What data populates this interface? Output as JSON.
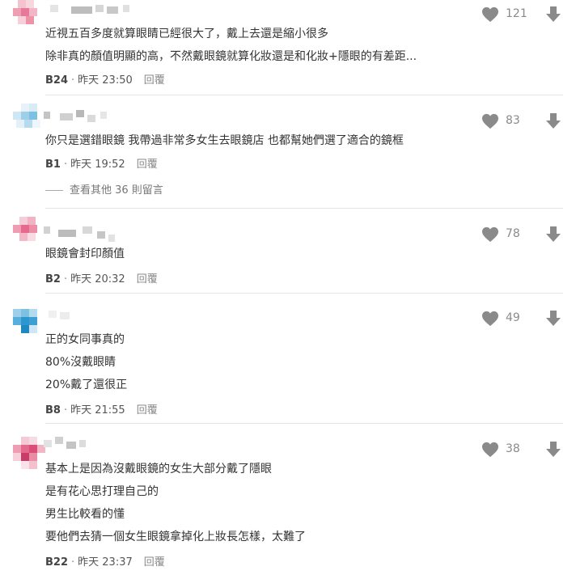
{
  "comments": [
    {
      "floor": "B24",
      "time": "昨天 23:50",
      "reply": "回覆",
      "likes": "121",
      "lines": [
        "近視五百多度就算眼睛已經很大了，戴上去還是縮小很多",
        "除非真的顏值明顯的高，不然戴眼鏡就算化妝還是和化妝+隱眼的有差距..."
      ]
    },
    {
      "floor": "B1",
      "time": "昨天 19:52",
      "reply": "回覆",
      "likes": "83",
      "lines": [
        "你只是選錯眼鏡 我帶過非常多女生去眼鏡店 也都幫她們選了適合的鏡框"
      ],
      "more_replies": "查看其他 36 則留言"
    },
    {
      "floor": "B2",
      "time": "昨天 20:32",
      "reply": "回覆",
      "likes": "78",
      "lines": [
        "眼鏡會封印顏值"
      ]
    },
    {
      "floor": "B8",
      "time": "昨天 21:55",
      "reply": "回覆",
      "likes": "49",
      "lines": [
        "正的女同事真的",
        "80%沒戴眼睛",
        "20%戴了還很正"
      ]
    },
    {
      "floor": "B22",
      "time": "昨天 23:37",
      "reply": "回覆",
      "likes": "38",
      "lines": [
        "基本上是因為沒戴眼鏡的女生大部分戴了隱眼",
        "是有花心思打理自己的",
        "男生比較看的懂",
        "要他們去猜一個女生眼鏡拿掉化上妝長怎樣，太難了"
      ]
    }
  ],
  "icons": {
    "like": "heart-icon",
    "dislike": "arrow-down-icon"
  },
  "colors": {
    "icon": "#8a8a8a",
    "divider": "#e5e5e5"
  }
}
